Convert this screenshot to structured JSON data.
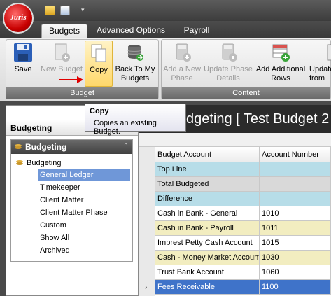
{
  "app": {
    "logo_text": "Juris"
  },
  "tabs": [
    {
      "label": "Budgets",
      "active": true
    },
    {
      "label": "Advanced Options",
      "active": false
    },
    {
      "label": "Payroll",
      "active": false
    }
  ],
  "ribbon": {
    "budget_group": {
      "label": "Budget",
      "buttons": [
        {
          "label": "Save",
          "enabled": true,
          "icon": "save-icon"
        },
        {
          "label": "New Budget",
          "enabled": false,
          "icon": "new-document-icon"
        },
        {
          "label": "Copy",
          "enabled": true,
          "icon": "copy-icon",
          "hovered": true
        },
        {
          "label": "Back To My Budgets",
          "enabled": true,
          "icon": "database-icon"
        }
      ]
    },
    "content_group": {
      "label": "Content",
      "buttons": [
        {
          "label": "Add a New Phase",
          "enabled": false,
          "icon": "calculator-icon"
        },
        {
          "label": "Update Phase Details",
          "enabled": false,
          "icon": "calculator-info-icon"
        },
        {
          "label": "Add Additional Rows",
          "enabled": true,
          "icon": "add-rows-icon"
        },
        {
          "label": "Update from",
          "enabled": true,
          "icon": "update-icon"
        }
      ]
    }
  },
  "tooltip": {
    "title": "Copy",
    "body": "Copies an existing Budget."
  },
  "left_pane": {
    "header": "Budgeting",
    "nav_title": "Budgeting",
    "tree_root": "Budgeting",
    "items": [
      {
        "label": "General Ledger",
        "selected": true
      },
      {
        "label": "Timekeeper",
        "selected": false
      },
      {
        "label": "Client Matter",
        "selected": false
      },
      {
        "label": "Client Matter Phase",
        "selected": false
      },
      {
        "label": "Custom",
        "selected": false
      },
      {
        "label": "Show All",
        "selected": false
      },
      {
        "label": "Archived",
        "selected": false
      }
    ]
  },
  "right_pane": {
    "title": "dgeting [ Test Budget 2",
    "columns": [
      "Budget Account",
      "Account Number"
    ],
    "rows": [
      {
        "account": "Top Line",
        "number": "",
        "style": "blue"
      },
      {
        "account": "Total Budgeted",
        "number": "",
        "style": "gray"
      },
      {
        "account": "Difference",
        "number": "",
        "style": "blue"
      },
      {
        "account": "Cash in Bank - General",
        "number": "1010",
        "style": "white"
      },
      {
        "account": "Cash in Bank - Payroll",
        "number": "1011",
        "style": "yellow"
      },
      {
        "account": "Imprest Petty Cash Account",
        "number": "1015",
        "style": "white"
      },
      {
        "account": "Cash - Money Market Account",
        "number": "1030",
        "style": "yellow"
      },
      {
        "account": "Trust Bank Account",
        "number": "1060",
        "style": "white"
      },
      {
        "account": "Fees Receivable",
        "number": "1100",
        "style": "selected"
      }
    ],
    "row_colors": {
      "blue": "#b7dde8",
      "gray": "#d9d9d9",
      "white": "#ffffff",
      "yellow": "#f2edc0",
      "selected": "#3f73c9"
    }
  }
}
